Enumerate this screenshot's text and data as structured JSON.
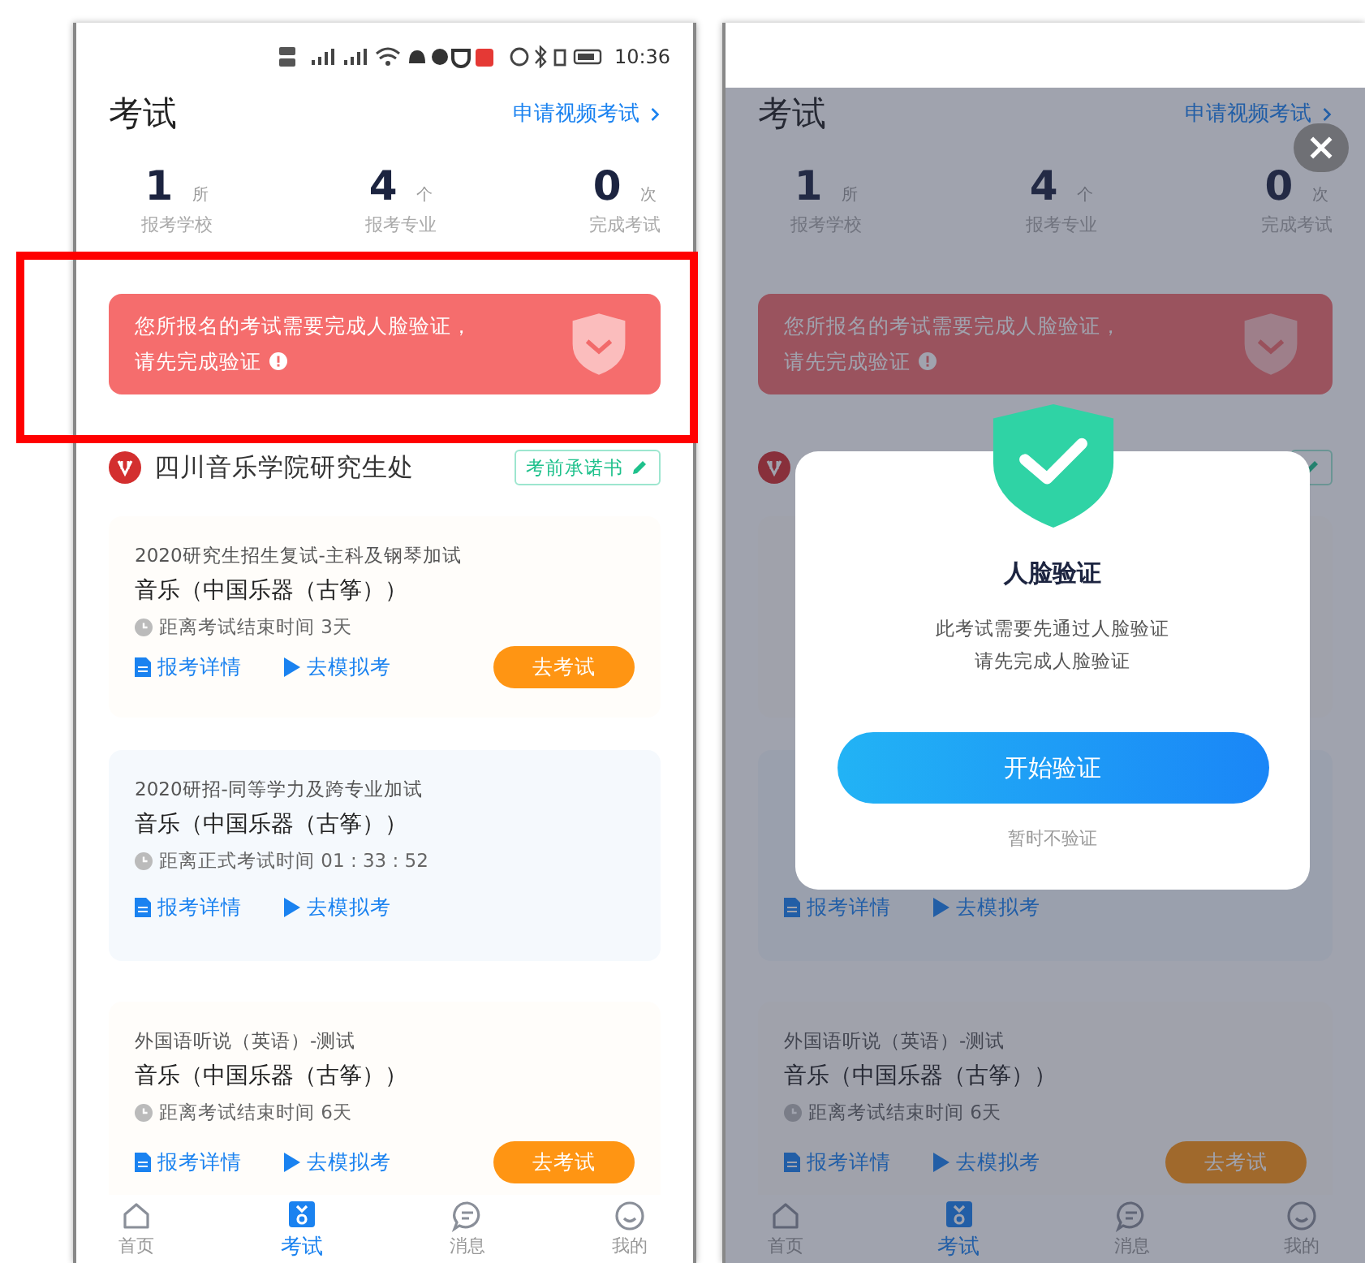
{
  "screens": [
    {
      "status_bar": {
        "time": "10:36"
      },
      "annotation_box": true,
      "header": {
        "title": "考试",
        "link": "申请视频考试"
      },
      "stats": [
        {
          "value": "1",
          "unit": "所",
          "label": "报考学校"
        },
        {
          "value": "4",
          "unit": "个",
          "label": "报考专业"
        },
        {
          "value": "0",
          "unit": "次",
          "label": "完成考试"
        }
      ],
      "banner": {
        "lines": [
          "您所报名的考试需要完成人脸验证，",
          "请先完成验证"
        ]
      },
      "school": {
        "name": "四川音乐学院研究生处",
        "pledge": "考前承诺书"
      },
      "cards": [
        {
          "kind": "full",
          "title": "2020研究生招生复试-主科及钢琴加试",
          "subject": "音乐（中国乐器（古筝））",
          "countdown": "距离考试结束时间 3天",
          "links": [
            "报考详情",
            "去模拟考"
          ],
          "action": "去考试"
        },
        {
          "kind": "full",
          "title": "2020研招-同等学力及跨专业加试",
          "subject": "音乐（中国乐器（古筝））",
          "countdown": "距离正式考试时间 01 : 33 : 52",
          "links": [
            "报考详情",
            "去模拟考"
          ]
        },
        {
          "kind": "full",
          "title": "外国语听说（英语）-测试",
          "subject": "音乐（中国乐器（古筝））",
          "countdown": "距离考试结束时间 6天",
          "links": [
            "报考详情",
            "去模拟考"
          ],
          "action": "去考试"
        }
      ],
      "tabs": [
        {
          "label": "首页",
          "selected": false
        },
        {
          "label": "考试",
          "selected": true
        },
        {
          "label": "消息",
          "selected": false
        },
        {
          "label": "我的",
          "selected": false
        }
      ]
    },
    {
      "annotation_box": false,
      "header": {
        "title": "考试",
        "link": "申请视频考试"
      },
      "stats": [
        {
          "value": "1",
          "unit": "所",
          "label": "报考学校"
        },
        {
          "value": "4",
          "unit": "个",
          "label": "报考专业"
        },
        {
          "value": "0",
          "unit": "次",
          "label": "完成考试"
        }
      ],
      "banner": {
        "lines": [
          "您所报名的考试需要完成人脸验证，",
          "请先完成验证"
        ]
      },
      "cards": [
        {
          "kind": "covered"
        },
        {
          "kind": "full",
          "links": [
            "报考详情",
            "去模拟考"
          ]
        },
        {
          "kind": "full",
          "title": "外国语听说（英语）-测试",
          "subject": "音乐（中国乐器（古筝））",
          "countdown": "距离考试结束时间 6天",
          "links": [
            "报考详情",
            "去模拟考"
          ],
          "action": "去考试"
        }
      ],
      "tabs": [
        {
          "label": "首页",
          "selected": false
        },
        {
          "label": "考试",
          "selected": true
        },
        {
          "label": "消息",
          "selected": false
        },
        {
          "label": "我的",
          "selected": false
        }
      ],
      "modal": {
        "title": "人脸验证",
        "lines": [
          "此考试需要先通过人脸验证",
          "请先完成人脸验证"
        ],
        "primary": "开始验证",
        "secondary": "暂时不验证"
      }
    }
  ]
}
